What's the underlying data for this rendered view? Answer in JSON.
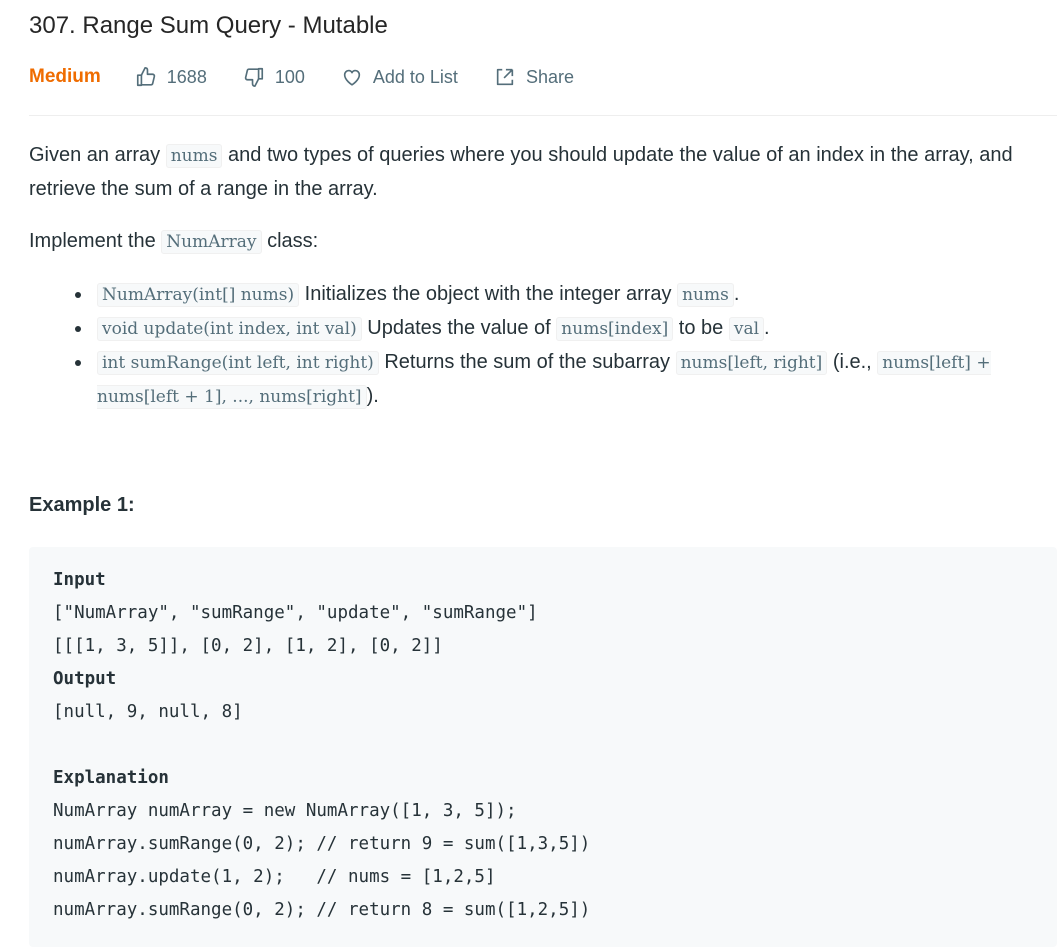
{
  "problem": {
    "title": "307. Range Sum Query - Mutable",
    "difficulty": "Medium",
    "likes": "1688",
    "dislikes": "100",
    "add_to_list": "Add to List",
    "share": "Share"
  },
  "description": {
    "p1_a": "Given an array ",
    "p1_code": "nums",
    "p1_b": " and two types of queries where you should update the value of an index in the array, and retrieve the sum of a range in the array.",
    "p2_a": "Implement the ",
    "p2_code": "NumArray",
    "p2_b": " class:",
    "items": [
      {
        "code": "NumArray(int[] nums)",
        "text_a": " Initializes the object with the integer array ",
        "code2": "nums",
        "text_b": "."
      },
      {
        "code": "void update(int index, int val)",
        "text_a": " Updates the value of ",
        "code2": "nums[index]",
        "text_b": " to be ",
        "code3": "val",
        "text_c": "."
      },
      {
        "code": "int sumRange(int left, int right)",
        "text_a": " Returns the sum of the subarray ",
        "code2": "nums[left, right]",
        "text_b": " (i.e., ",
        "code3": "nums[left] + nums[left + 1], ..., nums[right]",
        "text_c": ")."
      }
    ]
  },
  "example": {
    "title": "Example 1:",
    "input_label": "Input",
    "input_line1": "[\"NumArray\", \"sumRange\", \"update\", \"sumRange\"]",
    "input_line2": "[[[1, 3, 5]], [0, 2], [1, 2], [0, 2]]",
    "output_label": "Output",
    "output_line": "[null, 9, null, 8]",
    "explanation_label": "Explanation",
    "explanation_lines": [
      "NumArray numArray = new NumArray([1, 3, 5]);",
      "numArray.sumRange(0, 2); // return 9 = sum([1,3,5])",
      "numArray.update(1, 2);   // nums = [1,2,5]",
      "numArray.sumRange(0, 2); // return 8 = sum([1,2,5])"
    ]
  },
  "colors": {
    "difficulty": "#ef6c00",
    "meta": "#546e7a",
    "codebox_bg": "#f7f9fa"
  }
}
